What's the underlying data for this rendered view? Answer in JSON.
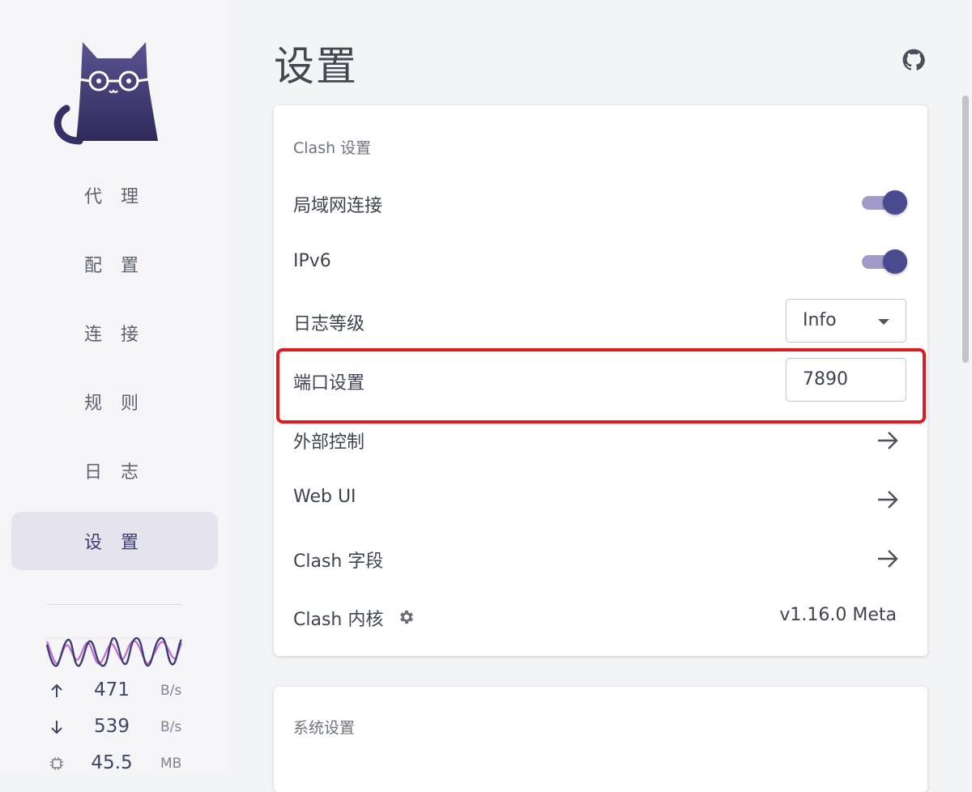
{
  "window": {
    "controls": [
      {
        "name": "close",
        "color": "#ff5f57"
      },
      {
        "name": "minimize",
        "color": "#febc2e"
      },
      {
        "name": "zoom",
        "color": "#28c840"
      }
    ]
  },
  "sidebar": {
    "logo_icon": "cat-with-glasses-logo",
    "items": [
      {
        "label": "代 理",
        "active": false
      },
      {
        "label": "配 置",
        "active": false
      },
      {
        "label": "连 接",
        "active": false
      },
      {
        "label": "规 则",
        "active": false
      },
      {
        "label": "日 志",
        "active": false
      },
      {
        "label": "设 置",
        "active": true
      }
    ],
    "traffic": {
      "upload": {
        "value": "471",
        "unit": "B/s",
        "icon": "arrow-up-icon"
      },
      "download": {
        "value": "539",
        "unit": "B/s",
        "icon": "arrow-down-icon"
      },
      "memory": {
        "value": "45.5",
        "unit": "MB",
        "icon": "memory-chip-icon"
      },
      "colors": {
        "upload": "#3c3d75",
        "download": "#c06bd1"
      }
    }
  },
  "header": {
    "title": "设置",
    "github_icon": "github-icon"
  },
  "clash_settings": {
    "section_title": "Clash 设置",
    "lan": {
      "label": "局域网连接",
      "enabled": true
    },
    "ipv6": {
      "label": "IPv6",
      "enabled": true
    },
    "log_level": {
      "label": "日志等级",
      "value": "Info"
    },
    "port": {
      "label": "端口设置",
      "value": "7890"
    },
    "external_control": {
      "label": "外部控制"
    },
    "web_ui": {
      "label": "Web UI"
    },
    "clash_fields": {
      "label": "Clash 字段"
    },
    "core": {
      "label": "Clash 内核",
      "version": "v1.16.0 Meta"
    }
  },
  "system_settings": {
    "section_title": "系统设置"
  },
  "colors": {
    "accent": "#4a4a8e",
    "highlight": "#e01a21"
  }
}
